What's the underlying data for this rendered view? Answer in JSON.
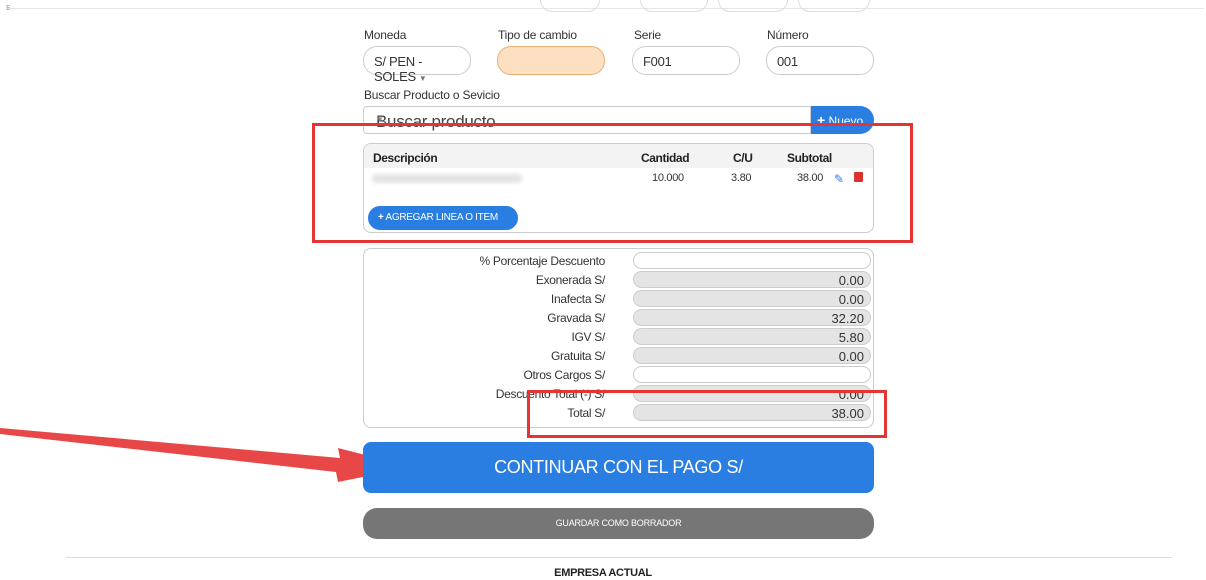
{
  "header": {
    "corner_mark": "E"
  },
  "form": {
    "moneda": {
      "label": "Moneda",
      "value": "S/ PEN - SOLES"
    },
    "tipo_cambio": {
      "label": "Tipo de cambio",
      "value": ""
    },
    "serie": {
      "label": "Serie",
      "value": "F001"
    },
    "numero": {
      "label": "Número",
      "value": "001"
    },
    "buscar": {
      "label": "Buscar Producto o Sevicio",
      "placeholder": "Buscar producto"
    },
    "nuevo_label": "Nuevo",
    "plus_icon_char": "+"
  },
  "items_table": {
    "headers": {
      "descripcion": "Descripción",
      "cantidad": "Cantidad",
      "cu": "C/U",
      "subtotal": "Subtotal"
    },
    "rows": [
      {
        "descripcion": "",
        "cantidad": "10.000",
        "cu": "3.80",
        "subtotal": "38.00"
      }
    ],
    "add_button": "AGREGAR LINEA O ITEM"
  },
  "totals": [
    {
      "label": "% Porcentaje Descuento",
      "value": "",
      "editable": true
    },
    {
      "label": "Exonerada S/",
      "value": "0.00",
      "editable": false
    },
    {
      "label": "Inafecta S/",
      "value": "0.00",
      "editable": false
    },
    {
      "label": "Gravada S/",
      "value": "32.20",
      "editable": false
    },
    {
      "label": "IGV S/",
      "value": "5.80",
      "editable": false
    },
    {
      "label": "Gratuita S/",
      "value": "0.00",
      "editable": false
    },
    {
      "label": "Otros Cargos S/",
      "value": "",
      "editable": true
    },
    {
      "label": "Descuento Total (-) S/",
      "value": "0.00",
      "editable": false
    },
    {
      "label": "Total S/",
      "value": "38.00",
      "editable": false
    }
  ],
  "actions": {
    "pay_button": "CONTINUAR CON EL PAGO S/",
    "draft_button": "GUARDAR COMO BORRADOR"
  },
  "footer": {
    "text": "EMPRESA ACTUAL"
  },
  "colors": {
    "primary": "#2a7de1",
    "annotation_red": "#e63333",
    "draft_gray": "#767676",
    "exchange_field": "#fde0c2"
  }
}
